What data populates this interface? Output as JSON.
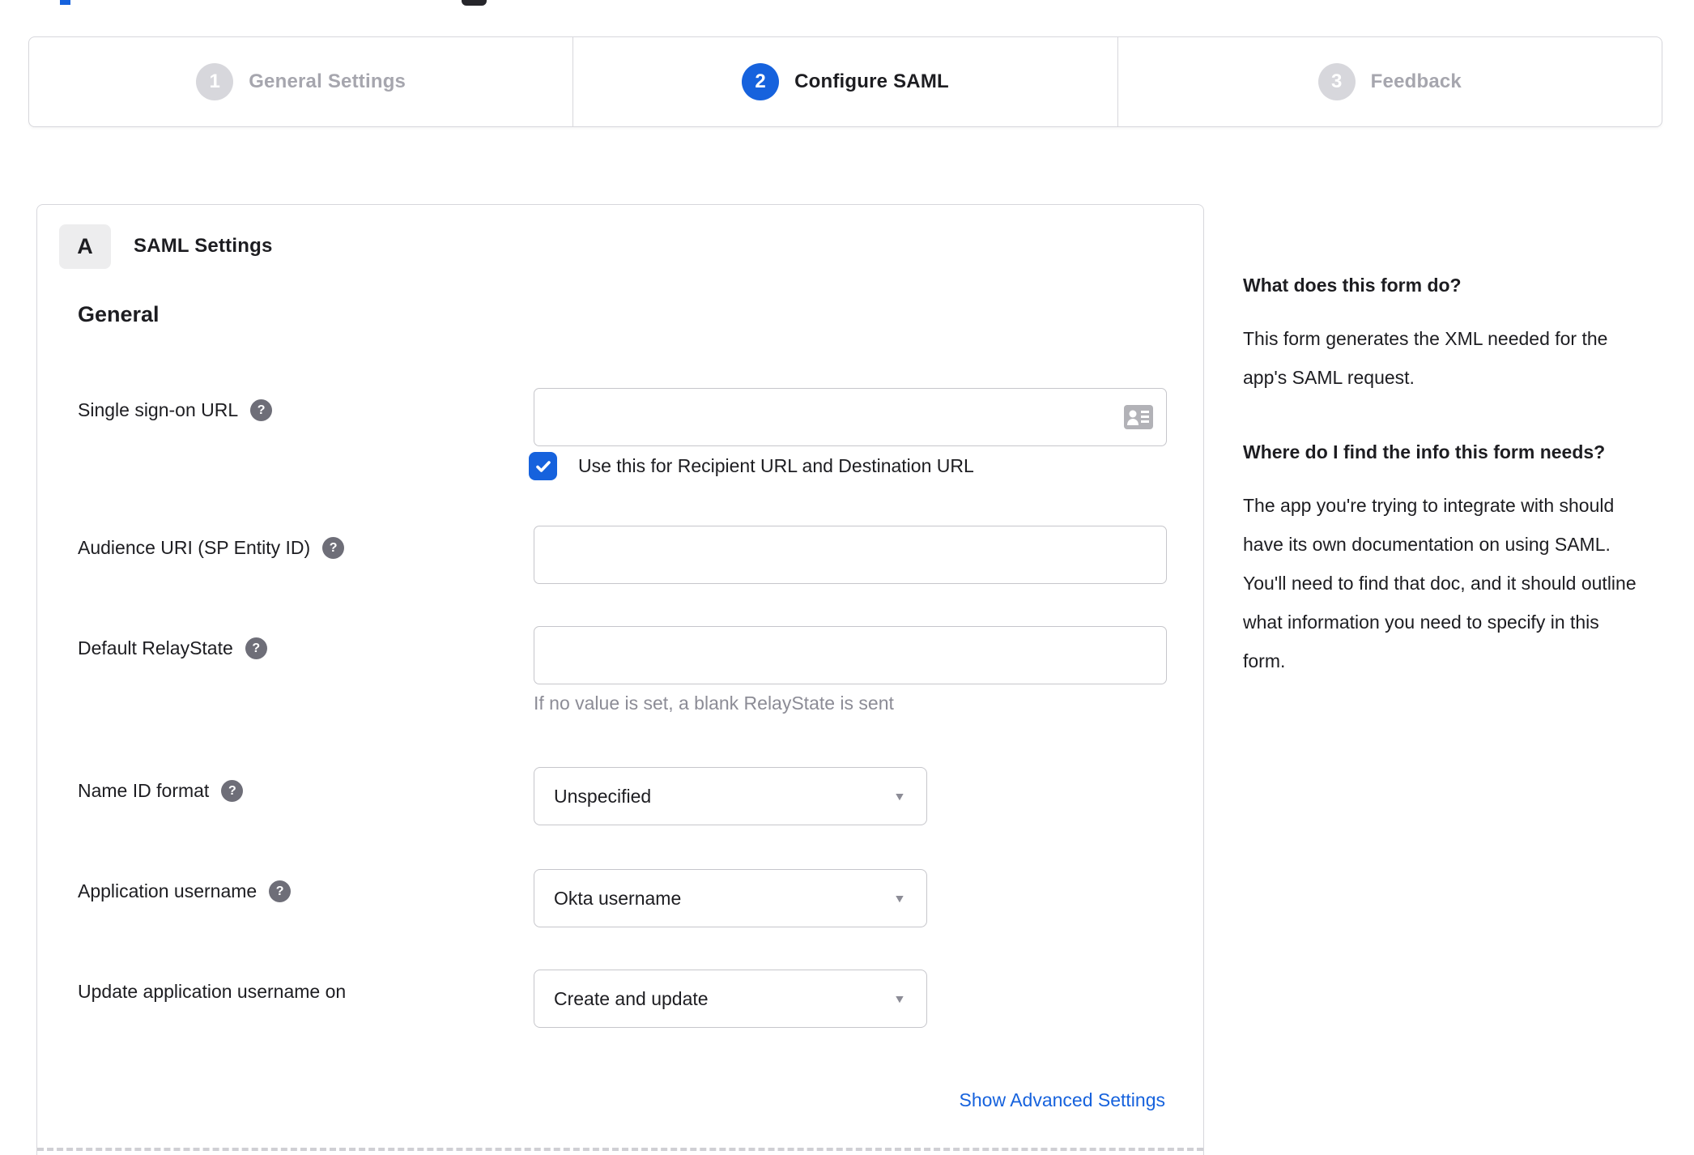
{
  "stepper": {
    "steps": [
      {
        "number": "1",
        "label": "General Settings",
        "state": "inactive"
      },
      {
        "number": "2",
        "label": "Configure SAML",
        "state": "active"
      },
      {
        "number": "3",
        "label": "Feedback",
        "state": "inactive"
      }
    ]
  },
  "panel": {
    "badge": "A",
    "title": "SAML Settings",
    "section_heading": "General",
    "form": {
      "sso": {
        "label": "Single sign-on URL",
        "value": "",
        "checkbox_label": "Use this for Recipient URL and Destination URL",
        "checked": true
      },
      "audience": {
        "label": "Audience URI (SP Entity ID)",
        "value": ""
      },
      "relay": {
        "label": "Default RelayState",
        "value": "",
        "hint": "If no value is set, a blank RelayState is sent"
      },
      "name_id": {
        "label": "Name ID format",
        "value": "Unspecified"
      },
      "app_username": {
        "label": "Application username",
        "value": "Okta username"
      },
      "update_username": {
        "label": "Update application username on",
        "value": "Create and update"
      }
    },
    "advanced_link": "Show Advanced Settings"
  },
  "help_sidebar": {
    "q1": "What does this form do?",
    "a1": "This form generates the XML needed for the app's SAML request.",
    "q2": "Where do I find the info this form needs?",
    "a2": "The app you're trying to integrate with should have its own documentation on using SAML. You'll need to find that doc, and it should outline what information you need to specify in this form."
  },
  "icons": {
    "help": "?",
    "caret": "▼",
    "contact_card": "contact-card-icon",
    "checkmark": "checkmark-icon"
  },
  "colors": {
    "accent": "#1662dd",
    "link": "#1662dd",
    "text": "#1d1d21",
    "muted": "#8c8c96",
    "border": "#d7d7dc",
    "input_border": "#c6c6cb",
    "inactive_step": "#d7d7dc"
  }
}
